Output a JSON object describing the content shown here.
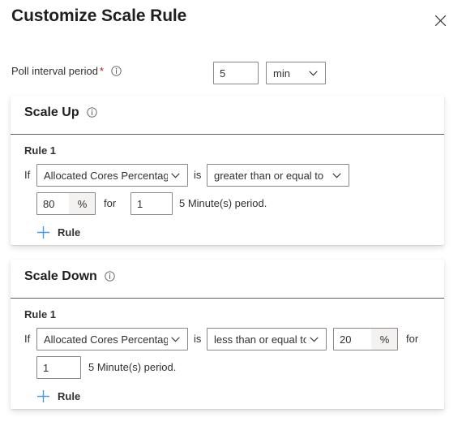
{
  "header": {
    "title": "Customize Scale Rule",
    "close_icon": "close-icon"
  },
  "poll_interval": {
    "label": "Poll interval period",
    "required_marker": "*",
    "info_icon": "info-icon",
    "value": "5",
    "unit": "min",
    "unit_chevron_icon": "chevron-down-icon"
  },
  "scale_up": {
    "title": "Scale Up",
    "info_icon": "info-icon",
    "rule_label": "Rule 1",
    "if_text": "If",
    "metric": "Allocated Cores Percentage",
    "is_text": "is",
    "operator": "greater than or equal to",
    "threshold": "80",
    "threshold_suffix": "%",
    "for_text": "for",
    "duration": "1",
    "period_text": "5 Minute(s) period.",
    "add_rule_label": "Rule",
    "add_rule_icon": "plus-icon"
  },
  "scale_down": {
    "title": "Scale Down",
    "info_icon": "info-icon",
    "rule_label": "Rule 1",
    "if_text": "If",
    "metric": "Allocated Cores Percentage",
    "is_text": "is",
    "operator": "less than or equal to",
    "threshold": "20",
    "threshold_suffix": "%",
    "for_text": "for",
    "duration": "1",
    "period_text": "5 Minute(s) period.",
    "add_rule_label": "Rule",
    "add_rule_icon": "plus-icon"
  },
  "colors": {
    "accent_blue": "#4a9ae0",
    "required_red": "#a4262c",
    "border_gray": "#8a8886",
    "divider_gray": "#605e5c",
    "suffix_bg": "#f3f2f1",
    "text_primary": "#323130"
  }
}
